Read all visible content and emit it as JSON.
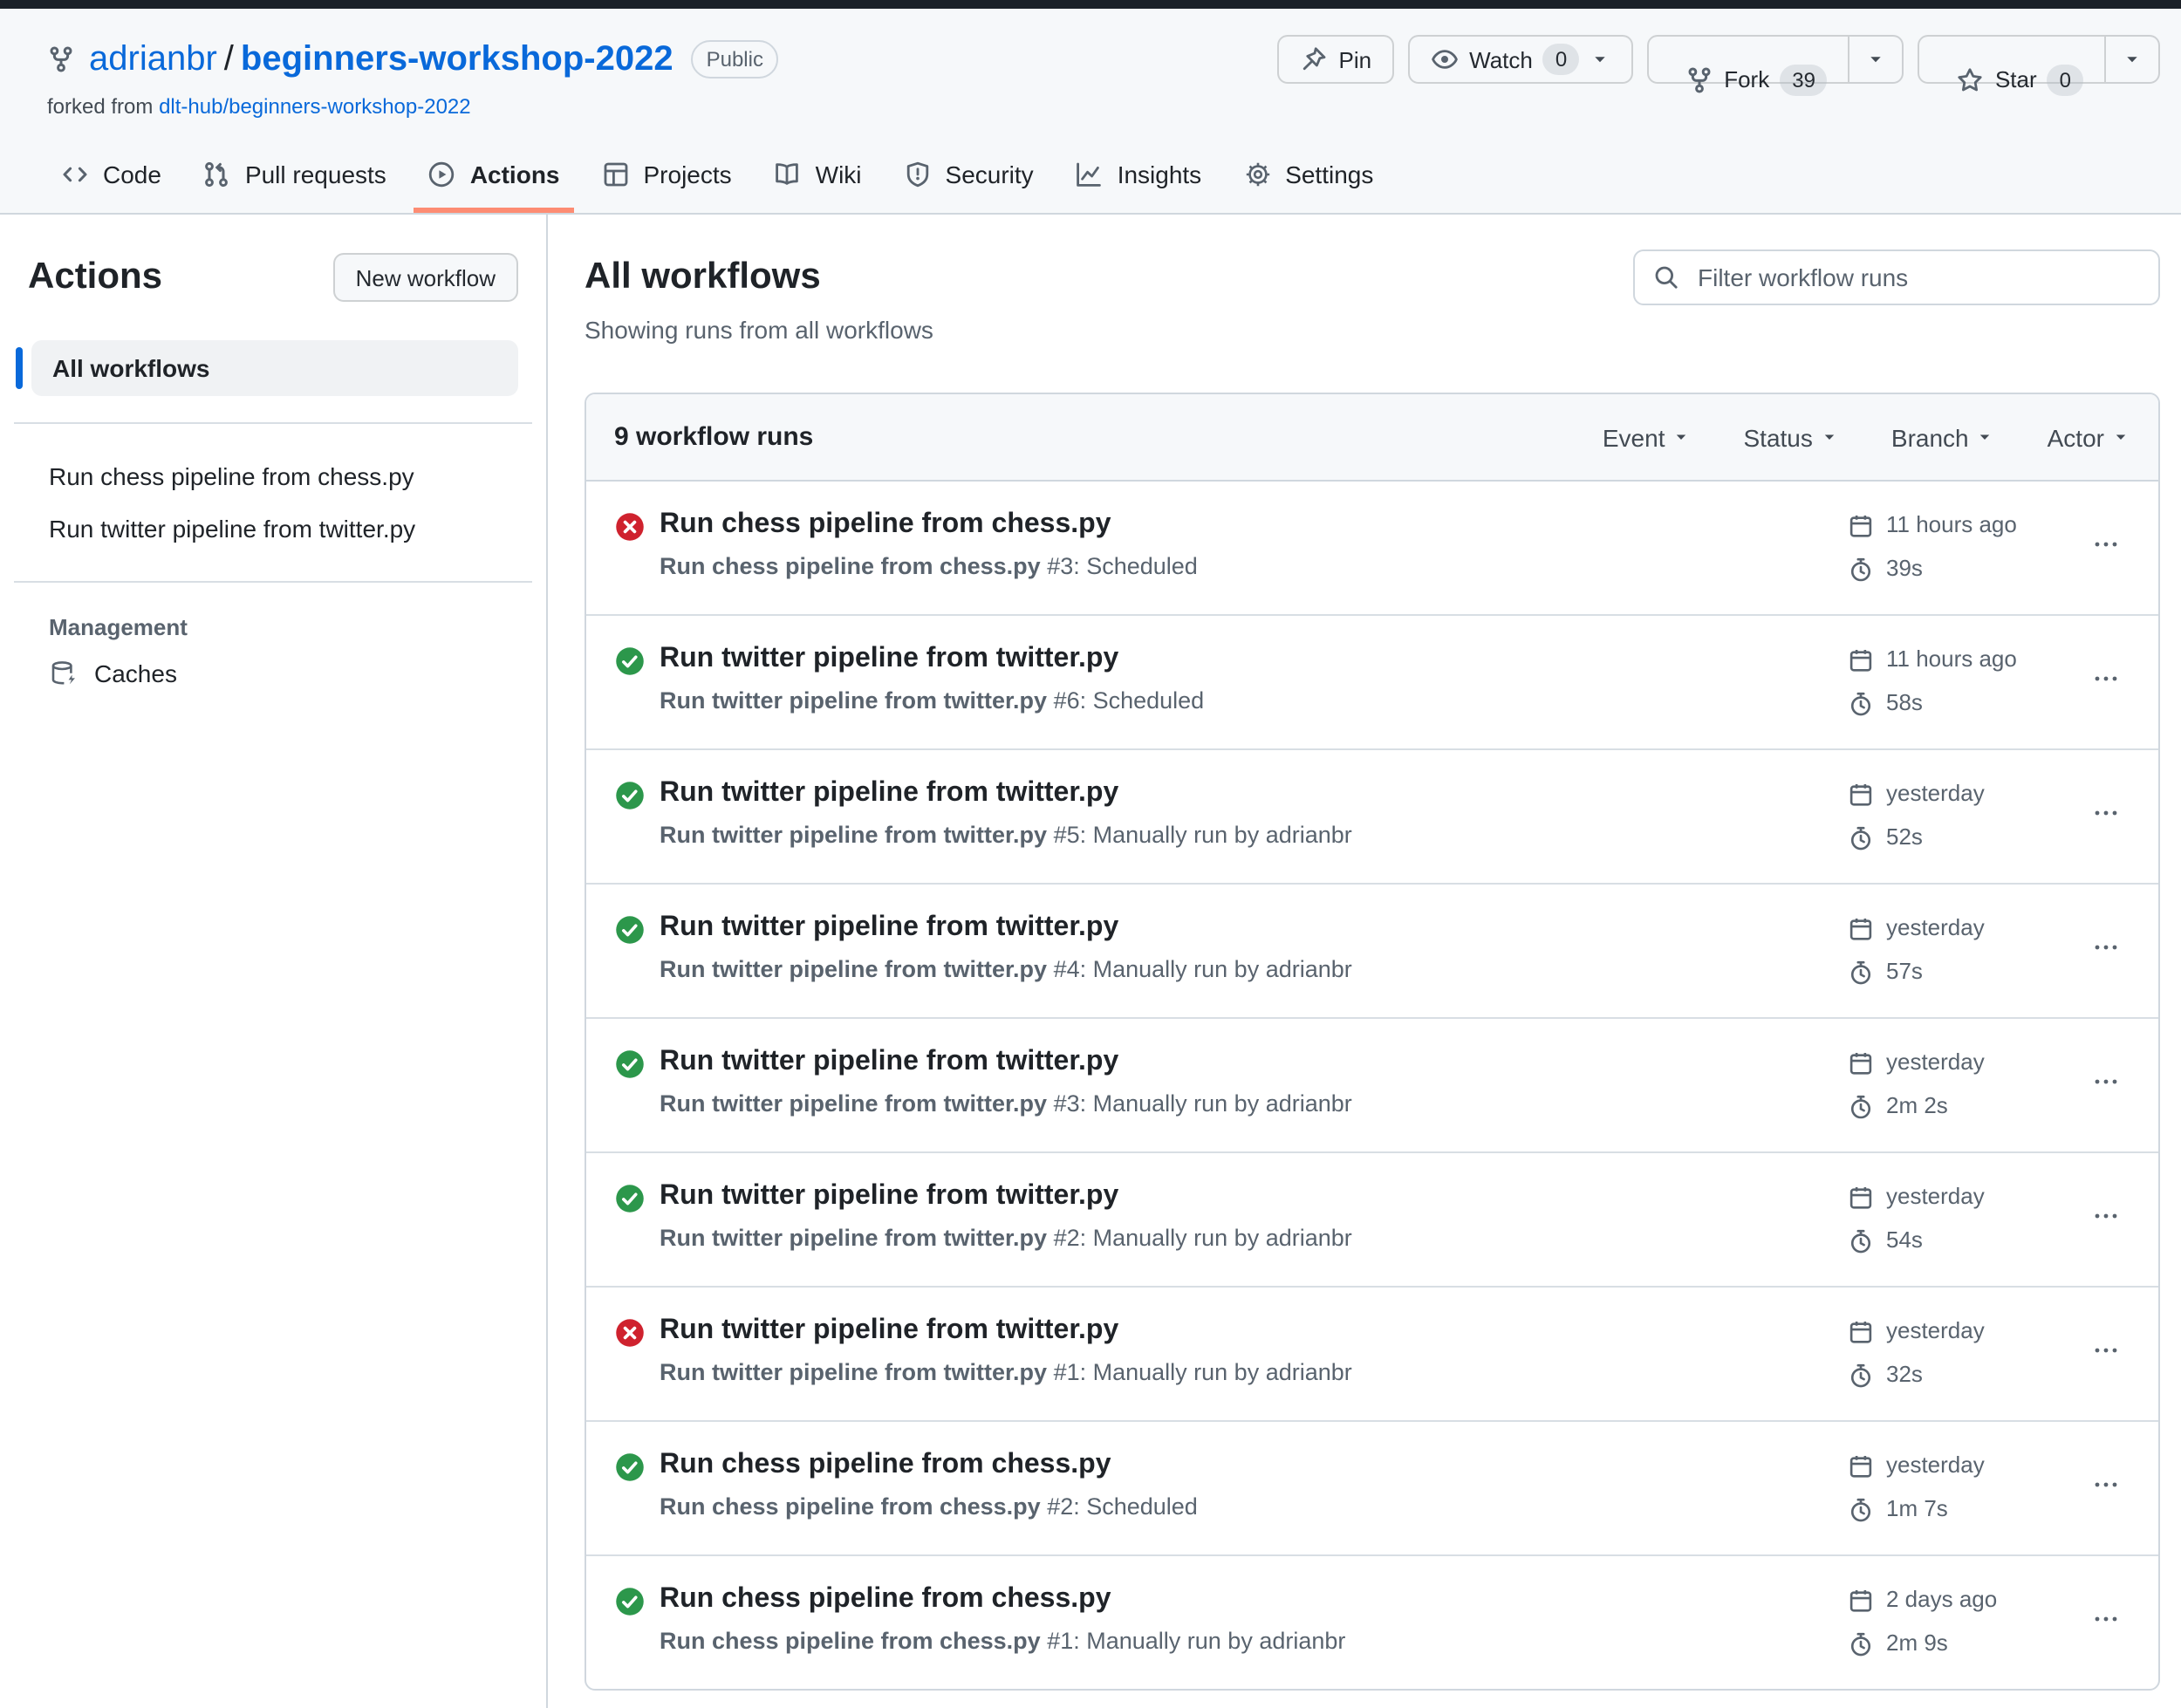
{
  "repo": {
    "owner": "adrianbr",
    "separator": "/",
    "name": "beginners-workshop-2022",
    "visibility": "Public",
    "forked_from_prefix": "forked from ",
    "forked_from_repo": "dlt-hub/beginners-workshop-2022"
  },
  "header_actions": {
    "pin_label": "Pin",
    "watch_label": "Watch",
    "watch_count": "0",
    "fork_label": "Fork",
    "fork_count": "39",
    "star_label": "Star",
    "star_count": "0"
  },
  "tabs": [
    {
      "label": "Code",
      "icon": "code-icon",
      "active": false
    },
    {
      "label": "Pull requests",
      "icon": "git-pull-request-icon",
      "active": false
    },
    {
      "label": "Actions",
      "icon": "play-icon",
      "active": true
    },
    {
      "label": "Projects",
      "icon": "table-icon",
      "active": false
    },
    {
      "label": "Wiki",
      "icon": "book-icon",
      "active": false
    },
    {
      "label": "Security",
      "icon": "shield-icon",
      "active": false
    },
    {
      "label": "Insights",
      "icon": "graph-icon",
      "active": false
    },
    {
      "label": "Settings",
      "icon": "gear-icon",
      "active": false
    }
  ],
  "sidebar": {
    "title": "Actions",
    "new_workflow_label": "New workflow",
    "all_workflows_label": "All workflows",
    "workflows": [
      "Run chess pipeline from chess.py",
      "Run twitter pipeline from twitter.py"
    ],
    "management_label": "Management",
    "caches_label": "Caches"
  },
  "main": {
    "title": "All workflows",
    "subtitle": "Showing runs from all workflows",
    "filter_placeholder": "Filter workflow runs",
    "table": {
      "count_label": "9 workflow runs",
      "filters": [
        "Event",
        "Status",
        "Branch",
        "Actor"
      ],
      "runs": [
        {
          "status": "failure",
          "title": "Run chess pipeline from chess.py",
          "sub_strong": "Run chess pipeline from chess.py",
          "sub_rest": "#3: Scheduled",
          "time": "11 hours ago",
          "duration": "39s"
        },
        {
          "status": "success",
          "title": "Run twitter pipeline from twitter.py",
          "sub_strong": "Run twitter pipeline from twitter.py",
          "sub_rest": "#6: Scheduled",
          "time": "11 hours ago",
          "duration": "58s"
        },
        {
          "status": "success",
          "title": "Run twitter pipeline from twitter.py",
          "sub_strong": "Run twitter pipeline from twitter.py",
          "sub_rest": "#5: Manually run by adrianbr",
          "time": "yesterday",
          "duration": "52s"
        },
        {
          "status": "success",
          "title": "Run twitter pipeline from twitter.py",
          "sub_strong": "Run twitter pipeline from twitter.py",
          "sub_rest": "#4: Manually run by adrianbr",
          "time": "yesterday",
          "duration": "57s"
        },
        {
          "status": "success",
          "title": "Run twitter pipeline from twitter.py",
          "sub_strong": "Run twitter pipeline from twitter.py",
          "sub_rest": "#3: Manually run by adrianbr",
          "time": "yesterday",
          "duration": "2m 2s"
        },
        {
          "status": "success",
          "title": "Run twitter pipeline from twitter.py",
          "sub_strong": "Run twitter pipeline from twitter.py",
          "sub_rest": "#2: Manually run by adrianbr",
          "time": "yesterday",
          "duration": "54s"
        },
        {
          "status": "failure",
          "title": "Run twitter pipeline from twitter.py",
          "sub_strong": "Run twitter pipeline from twitter.py",
          "sub_rest": "#1: Manually run by adrianbr",
          "time": "yesterday",
          "duration": "32s"
        },
        {
          "status": "success",
          "title": "Run chess pipeline from chess.py",
          "sub_strong": "Run chess pipeline from chess.py",
          "sub_rest": "#2: Scheduled",
          "time": "yesterday",
          "duration": "1m 7s"
        },
        {
          "status": "success",
          "title": "Run chess pipeline from chess.py",
          "sub_strong": "Run chess pipeline from chess.py",
          "sub_rest": "#1: Manually run by adrianbr",
          "time": "2 days ago",
          "duration": "2m 9s"
        }
      ]
    }
  },
  "colors": {
    "success": "#2c974b",
    "danger": "#cf222e",
    "accent": "#0969da",
    "tab_underline": "#fd8c73",
    "header_bg": "#f6f8fa",
    "border": "#d0d7de"
  }
}
